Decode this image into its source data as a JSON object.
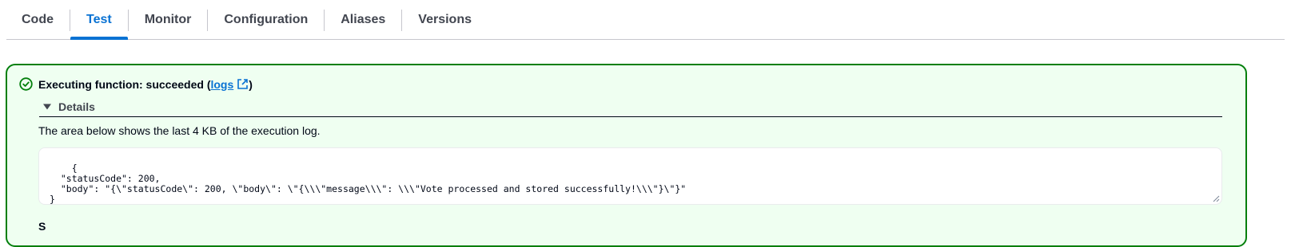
{
  "tabs": [
    {
      "label": "Code",
      "active": false
    },
    {
      "label": "Test",
      "active": true
    },
    {
      "label": "Monitor",
      "active": false
    },
    {
      "label": "Configuration",
      "active": false
    },
    {
      "label": "Aliases",
      "active": false
    },
    {
      "label": "Versions",
      "active": false
    }
  ],
  "alert": {
    "status": "success",
    "icon": "check-circle-icon",
    "title_prefix": "Executing function: succeeded (",
    "logs_link": "logs",
    "link_icon": "external-link-icon",
    "title_suffix": ")",
    "details_label": "Details",
    "details_expanded": true,
    "description": "The area below shows the last 4 KB of the execution log.",
    "log_output": "{\n  \"statusCode\": 200,\n  \"body\": \"{\\\"statusCode\\\": 200, \\\"body\\\": \\\"{\\\\\\\"message\\\\\\\": \\\\\\\"Vote processed and stored successfully!\\\\\\\"}\\\"}\"\n}",
    "next_section_heading": "S"
  },
  "colors": {
    "accent": "#0972d3",
    "success_border": "#037f0c",
    "success_background": "#effff1"
  }
}
